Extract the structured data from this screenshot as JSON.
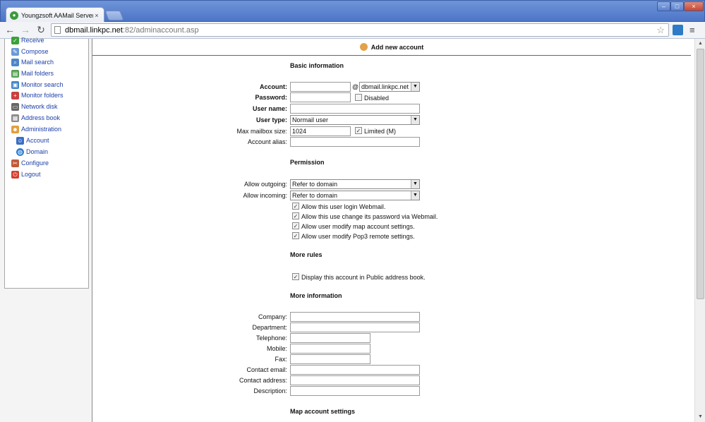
{
  "browser": {
    "tab_title": "Youngzsoft AAMail Server",
    "tab_close": "×",
    "url_host": "dbmail.linkpc.net",
    "url_rest": ":82/adminaccount.asp",
    "controls": {
      "minimize": "–",
      "maximize": "□",
      "close": "×"
    },
    "icons": {
      "back": "←",
      "forward": "→",
      "reload": "↻",
      "star": "☆",
      "menu": "≡"
    }
  },
  "sidebar": {
    "items": [
      {
        "label": "Receive",
        "icon": "receive-icon",
        "color": "#3aa03a"
      },
      {
        "label": "Compose",
        "icon": "compose-icon",
        "color": "#6a9ad8"
      },
      {
        "label": "Mail search",
        "icon": "search-icon",
        "color": "#4d86c8"
      },
      {
        "label": "Mail folders",
        "icon": "folders-icon",
        "color": "#52a052"
      },
      {
        "label": "Monitor search",
        "icon": "monitor-search-icon",
        "color": "#3d86c6"
      },
      {
        "label": "Monitor folders",
        "icon": "monitor-folders-icon",
        "color": "#c84040"
      },
      {
        "label": "Network disk",
        "icon": "disk-icon",
        "color": "#666666"
      },
      {
        "label": "Address book",
        "icon": "address-book-icon",
        "color": "#8a8a8a"
      },
      {
        "label": "Administration",
        "icon": "admin-icon",
        "color": "#e0a040"
      },
      {
        "label": "Account",
        "icon": "account-icon",
        "color": "#3a6fc4"
      },
      {
        "label": "Domain",
        "icon": "domain-icon",
        "color": "#2e7fd0"
      },
      {
        "label": "Configure",
        "icon": "configure-icon",
        "color": "#c05a3a"
      },
      {
        "label": "Logout",
        "icon": "logout-icon",
        "color": "#d04030"
      }
    ]
  },
  "header": {
    "title": "Add new account"
  },
  "basic": {
    "title": "Basic information",
    "account_label": "Account:",
    "at": "@",
    "domain_value": "dbmail.linkpc.net",
    "password_label": "Password:",
    "disabled_label": "Disabled",
    "username_label": "User name:",
    "usertype_label": "User type:",
    "usertype_value": "Normail user",
    "mailbox_label": "Max mailbox size:",
    "mailbox_value": "1024",
    "limited_label": "Limited (M)",
    "alias_label": "Account alias:"
  },
  "permission": {
    "title": "Permission",
    "outgoing_label": "Allow outgoing:",
    "outgoing_value": "Refer to domain",
    "incoming_label": "Allow incoming:",
    "incoming_value": "Refer to domain",
    "checks": [
      "Allow this user login Webmail.",
      "Allow this use change its password via Webmail.",
      "Allow user modify map account settings.",
      "Allow user modify Pop3 remote settings."
    ]
  },
  "more_rules": {
    "title": "More rules",
    "check": "Display this account in Public address book."
  },
  "more_info": {
    "title": "More information",
    "company": "Company:",
    "department": "Department:",
    "telephone": "Telephone:",
    "mobile": "Mobile:",
    "fax": "Fax:",
    "contact_email": "Contact email:",
    "contact_address": "Contact address:",
    "description": "Description:"
  },
  "map": {
    "title": "Map account settings"
  }
}
